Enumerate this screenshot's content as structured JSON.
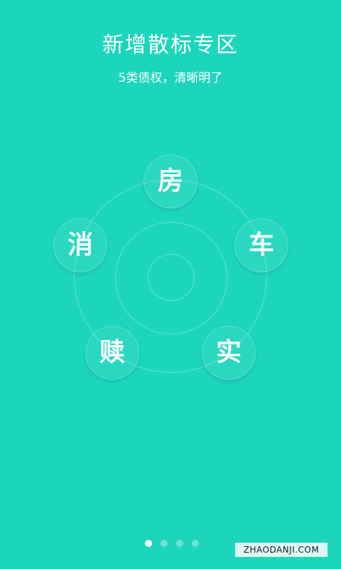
{
  "header": {
    "title": "新增散标专区",
    "subtitle": "5类债权，清晰明了"
  },
  "categories": [
    {
      "label": "房"
    },
    {
      "label": "车"
    },
    {
      "label": "实"
    },
    {
      "label": "赎"
    },
    {
      "label": "消"
    }
  ],
  "pager": {
    "count": 4,
    "active_index": 0
  },
  "watermark": {
    "text": "ZHAODANJI.COM"
  },
  "colors": {
    "background": "#1cd6bc",
    "text": "#ffffff"
  }
}
